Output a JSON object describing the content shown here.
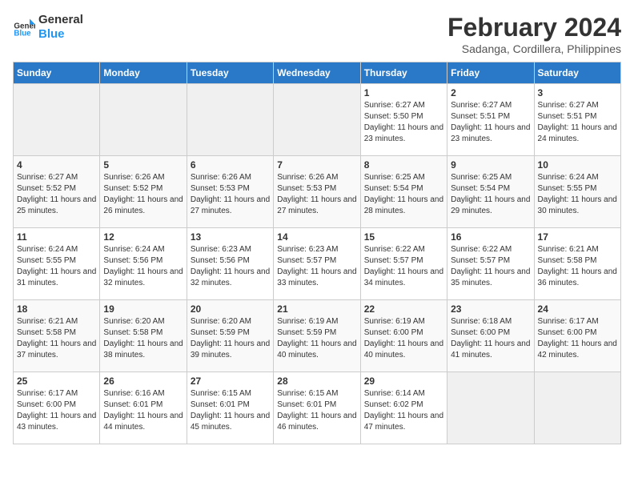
{
  "logo": {
    "line1": "General",
    "line2": "Blue"
  },
  "title": "February 2024",
  "subtitle": "Sadanga, Cordillera, Philippines",
  "days_header": [
    "Sunday",
    "Monday",
    "Tuesday",
    "Wednesday",
    "Thursday",
    "Friday",
    "Saturday"
  ],
  "weeks": [
    [
      {
        "day": "",
        "info": ""
      },
      {
        "day": "",
        "info": ""
      },
      {
        "day": "",
        "info": ""
      },
      {
        "day": "",
        "info": ""
      },
      {
        "day": "1",
        "info": "Sunrise: 6:27 AM\nSunset: 5:50 PM\nDaylight: 11 hours and 23 minutes."
      },
      {
        "day": "2",
        "info": "Sunrise: 6:27 AM\nSunset: 5:51 PM\nDaylight: 11 hours and 23 minutes."
      },
      {
        "day": "3",
        "info": "Sunrise: 6:27 AM\nSunset: 5:51 PM\nDaylight: 11 hours and 24 minutes."
      }
    ],
    [
      {
        "day": "4",
        "info": "Sunrise: 6:27 AM\nSunset: 5:52 PM\nDaylight: 11 hours and 25 minutes."
      },
      {
        "day": "5",
        "info": "Sunrise: 6:26 AM\nSunset: 5:52 PM\nDaylight: 11 hours and 26 minutes."
      },
      {
        "day": "6",
        "info": "Sunrise: 6:26 AM\nSunset: 5:53 PM\nDaylight: 11 hours and 27 minutes."
      },
      {
        "day": "7",
        "info": "Sunrise: 6:26 AM\nSunset: 5:53 PM\nDaylight: 11 hours and 27 minutes."
      },
      {
        "day": "8",
        "info": "Sunrise: 6:25 AM\nSunset: 5:54 PM\nDaylight: 11 hours and 28 minutes."
      },
      {
        "day": "9",
        "info": "Sunrise: 6:25 AM\nSunset: 5:54 PM\nDaylight: 11 hours and 29 minutes."
      },
      {
        "day": "10",
        "info": "Sunrise: 6:24 AM\nSunset: 5:55 PM\nDaylight: 11 hours and 30 minutes."
      }
    ],
    [
      {
        "day": "11",
        "info": "Sunrise: 6:24 AM\nSunset: 5:55 PM\nDaylight: 11 hours and 31 minutes."
      },
      {
        "day": "12",
        "info": "Sunrise: 6:24 AM\nSunset: 5:56 PM\nDaylight: 11 hours and 32 minutes."
      },
      {
        "day": "13",
        "info": "Sunrise: 6:23 AM\nSunset: 5:56 PM\nDaylight: 11 hours and 32 minutes."
      },
      {
        "day": "14",
        "info": "Sunrise: 6:23 AM\nSunset: 5:57 PM\nDaylight: 11 hours and 33 minutes."
      },
      {
        "day": "15",
        "info": "Sunrise: 6:22 AM\nSunset: 5:57 PM\nDaylight: 11 hours and 34 minutes."
      },
      {
        "day": "16",
        "info": "Sunrise: 6:22 AM\nSunset: 5:57 PM\nDaylight: 11 hours and 35 minutes."
      },
      {
        "day": "17",
        "info": "Sunrise: 6:21 AM\nSunset: 5:58 PM\nDaylight: 11 hours and 36 minutes."
      }
    ],
    [
      {
        "day": "18",
        "info": "Sunrise: 6:21 AM\nSunset: 5:58 PM\nDaylight: 11 hours and 37 minutes."
      },
      {
        "day": "19",
        "info": "Sunrise: 6:20 AM\nSunset: 5:58 PM\nDaylight: 11 hours and 38 minutes."
      },
      {
        "day": "20",
        "info": "Sunrise: 6:20 AM\nSunset: 5:59 PM\nDaylight: 11 hours and 39 minutes."
      },
      {
        "day": "21",
        "info": "Sunrise: 6:19 AM\nSunset: 5:59 PM\nDaylight: 11 hours and 40 minutes."
      },
      {
        "day": "22",
        "info": "Sunrise: 6:19 AM\nSunset: 6:00 PM\nDaylight: 11 hours and 40 minutes."
      },
      {
        "day": "23",
        "info": "Sunrise: 6:18 AM\nSunset: 6:00 PM\nDaylight: 11 hours and 41 minutes."
      },
      {
        "day": "24",
        "info": "Sunrise: 6:17 AM\nSunset: 6:00 PM\nDaylight: 11 hours and 42 minutes."
      }
    ],
    [
      {
        "day": "25",
        "info": "Sunrise: 6:17 AM\nSunset: 6:00 PM\nDaylight: 11 hours and 43 minutes."
      },
      {
        "day": "26",
        "info": "Sunrise: 6:16 AM\nSunset: 6:01 PM\nDaylight: 11 hours and 44 minutes."
      },
      {
        "day": "27",
        "info": "Sunrise: 6:15 AM\nSunset: 6:01 PM\nDaylight: 11 hours and 45 minutes."
      },
      {
        "day": "28",
        "info": "Sunrise: 6:15 AM\nSunset: 6:01 PM\nDaylight: 11 hours and 46 minutes."
      },
      {
        "day": "29",
        "info": "Sunrise: 6:14 AM\nSunset: 6:02 PM\nDaylight: 11 hours and 47 minutes."
      },
      {
        "day": "",
        "info": ""
      },
      {
        "day": "",
        "info": ""
      }
    ]
  ]
}
